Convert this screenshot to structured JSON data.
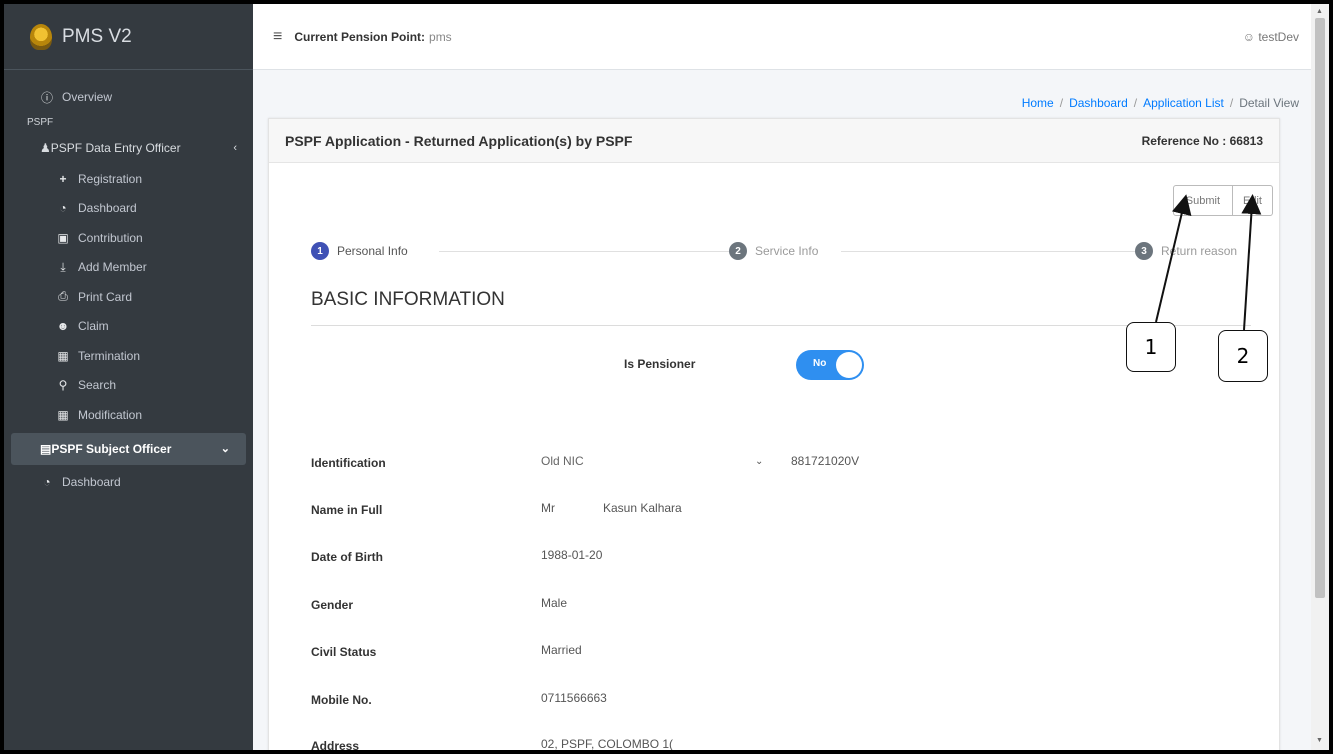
{
  "brand": {
    "name": "PMS V2"
  },
  "topbar": {
    "pension_label": "Current Pension Point:",
    "pension_value": "pms",
    "user": "testDev"
  },
  "sidebar": {
    "overview": "Overview",
    "header": "PSPF",
    "group1": "PSPF Data Entry Officer",
    "group1_items": [
      "Registration",
      "Dashboard",
      "Contribution",
      "Add Member",
      "Print Card",
      "Claim",
      "Termination",
      "Search",
      "Modification"
    ],
    "group2": "PSPF Subject Officer",
    "group2_items": [
      "Dashboard"
    ]
  },
  "breadcrumb": [
    "Home",
    "Dashboard",
    "Application List",
    "Detail View"
  ],
  "card": {
    "title": "PSPF Application - Returned Application(s) by PSPF",
    "reference": "Reference No : 66813",
    "submit_label": "Submit",
    "edit_label": "Edit"
  },
  "steps": [
    {
      "num": "1",
      "label": "Personal Info"
    },
    {
      "num": "2",
      "label": "Service Info"
    },
    {
      "num": "3",
      "label": "Return reason"
    }
  ],
  "section_title": "BASIC INFORMATION",
  "pensioner": {
    "label": "Is Pensioner",
    "toggle": "No"
  },
  "fields": {
    "identification": {
      "label": "Identification",
      "type": "Old NIC",
      "value": "881721020V"
    },
    "name": {
      "label": "Name in Full",
      "title": "Mr",
      "value": "Kasun Kalhara"
    },
    "dob": {
      "label": "Date of Birth",
      "value": "1988-01-20"
    },
    "gender": {
      "label": "Gender",
      "value": "Male"
    },
    "civil": {
      "label": "Civil Status",
      "value": "Married"
    },
    "mobile": {
      "label": "Mobile No.",
      "value": "0711566663"
    },
    "address": {
      "label": "Address",
      "value": "02, PSPF, COLOMBO 1("
    }
  },
  "annotations": [
    "1",
    "2"
  ],
  "icons": {
    "overview": "info-circle-icon",
    "group1": "users-icon",
    "registration": "plus-icon",
    "dashboard": "tachometer-icon",
    "contribution": "money-icon",
    "add_member": "download-icon",
    "print": "print-icon",
    "claim": "user-badge-icon",
    "termination": "square-icon",
    "search": "search-icon",
    "modification": "square-icon",
    "group2": "box-icon",
    "user": "user-icon"
  }
}
